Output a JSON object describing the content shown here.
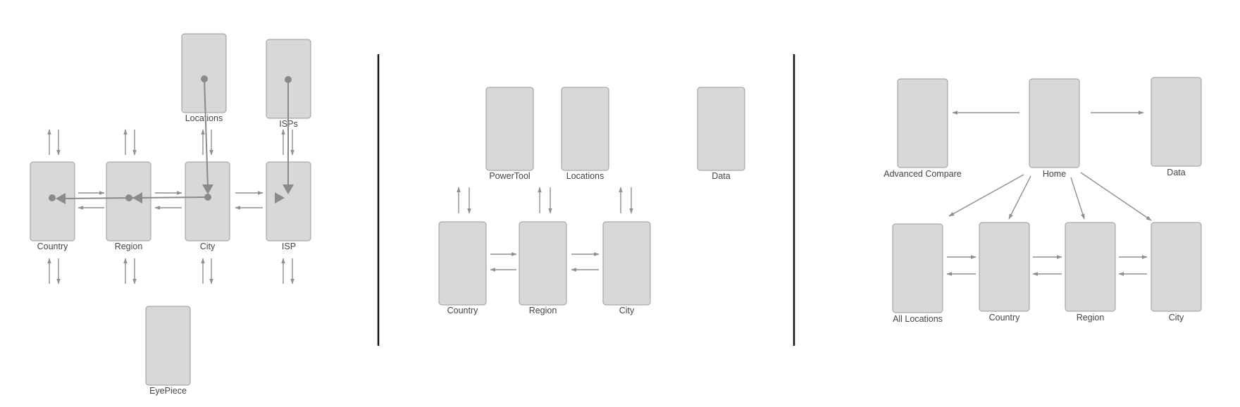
{
  "panel1": {
    "screens": {
      "locations": "Locations",
      "isps": "ISPs",
      "country": "Country",
      "region": "Region",
      "city": "City",
      "isp": "ISP",
      "eyepiece": "EyePiece"
    }
  },
  "panel2": {
    "screens": {
      "powertool": "PowerTool",
      "locations": "Locations",
      "data": "Data",
      "country": "Country",
      "region": "Region",
      "city": "City"
    }
  },
  "panel3": {
    "screens": {
      "advanced_compare": "Advanced Compare",
      "home": "Home",
      "data": "Data",
      "all_locations": "All Locations",
      "country": "Country",
      "region": "Region",
      "city": "City"
    }
  },
  "colors": {
    "screen_fill": "#d8d8d8",
    "screen_border": "#9a9a9a",
    "arrow": "#8f8f8f",
    "divider": "#111111"
  }
}
